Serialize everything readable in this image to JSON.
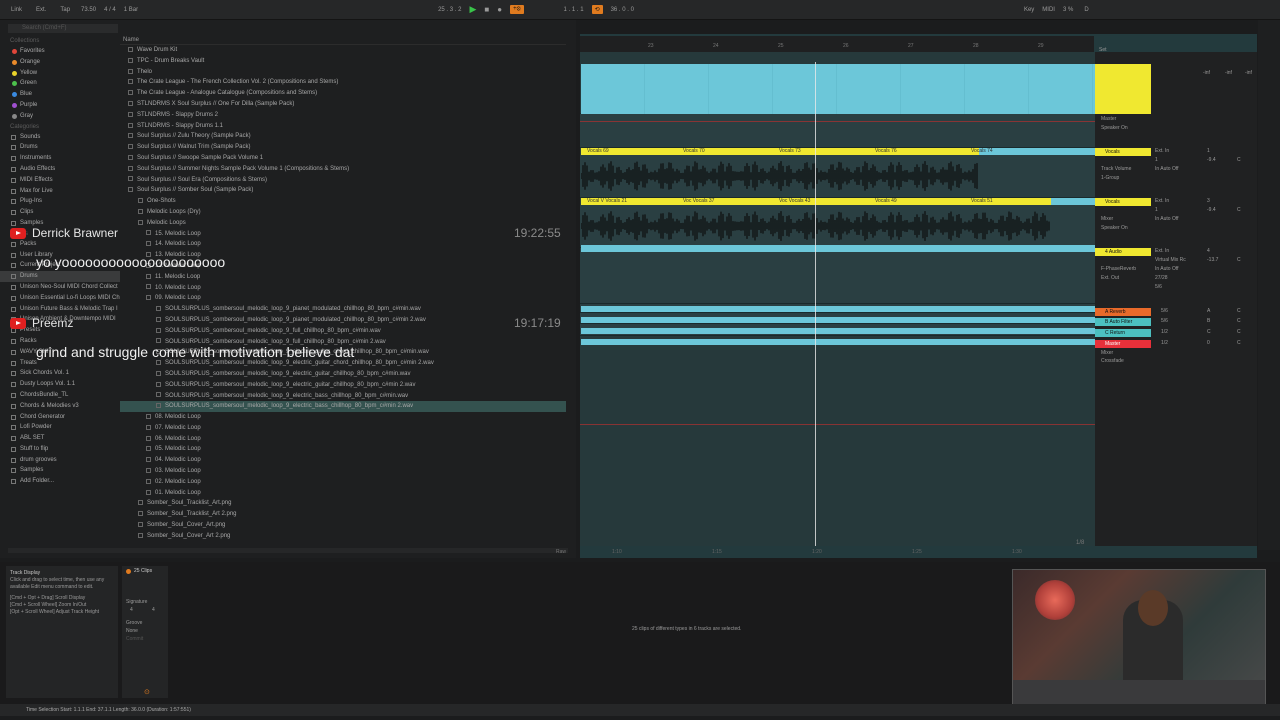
{
  "topbar": {
    "link": "Link",
    "ext": "Ext.",
    "tap": "Tap",
    "tempo": "73.50",
    "sig": "4 / 4",
    "quant": "1 Bar",
    "position": "25 . 3 . 2",
    "loop_start": "1 . 1 . 1",
    "loop_len": "36 . 0 . 0",
    "key": "Key",
    "midi": "MIDI",
    "cpu": "3 %",
    "d_btn": "D"
  },
  "browser": {
    "search_placeholder": "Search (Cmd+F)",
    "collections_header": "Collections",
    "collections": [
      {
        "label": "Favorites",
        "color": "#e0463a"
      },
      {
        "label": "Orange",
        "color": "#e88a2a"
      },
      {
        "label": "Yellow",
        "color": "#e8d22a"
      },
      {
        "label": "Green",
        "color": "#4cc04c"
      },
      {
        "label": "Blue",
        "color": "#3a8ae0"
      },
      {
        "label": "Purple",
        "color": "#a050d0"
      },
      {
        "label": "Gray",
        "color": "#888888"
      }
    ],
    "categories_header": "Categories",
    "categories": [
      "Sounds",
      "Drums",
      "Instruments",
      "Audio Effects",
      "MIDI Effects",
      "Max for Live",
      "Plug-Ins",
      "Clips",
      "Samples"
    ],
    "places_header": "Places",
    "places": [
      "Packs",
      "User Library",
      "Current Project",
      "Drums",
      "Unison Neo-Soul MIDI Chord Collect",
      "Unison Essential Lo-fi Loops MIDI Ch",
      "Unison Future Bass & Melodic Trap I",
      "Unison Ambient & Downtempo MIDI",
      "Presets",
      "Racks",
      "WAVY SHIT",
      "Treats",
      "Sick Chords Vol. 1",
      "Dusty Loops Vol. 1.1",
      "ChordsBundle_TL",
      "Chords & Melodies v3",
      "Chord Generator",
      "Lofi Powder",
      "ABL SET",
      "Stuff to flip",
      "drum grooves",
      "Samples",
      "Add Folder..."
    ],
    "name_header": "Name",
    "files": [
      "Wave Drum Kit",
      "TPC - Drum Breaks Vault",
      "Thelo",
      "The Crate League - The French Collection Vol. 2 (Compositions and Stems)",
      "The Crate League - Analogue Catalogue (Compositions and Stems)",
      "STLNDRMS X Soul Surplus // One For Dilla (Sample Pack)",
      "STLNDRMS - Slappy Drums 2",
      "STLNDRMS - Slappy Drums 1.1",
      "Soul Surplus // Zulu Theory (Sample Pack)",
      "Soul Surplus // Walnut Trim (Sample Pack)",
      "Soul Surplus // Swoope Sample Pack Volume 1",
      "Soul Surplus // Summer Nights Sample Pack Volume 1 (Compositions & Stems)",
      "Soul Surplus // Soul Era (Compositions & Stems)",
      "Soul Surplus // Somber Soul (Sample Pack)",
      "One-Shots",
      "Melodic Loops (Dry)",
      "Melodic Loops",
      "15. Melodic Loop",
      "14. Melodic Loop",
      "13. Melodic Loop",
      "12. Melodic Loop",
      "11. Melodic Loop",
      "10. Melodic Loop",
      "09. Melodic Loop",
      "SOULSURPLUS_sombersoul_melodic_loop_9_pianet_modulated_chillhop_80_bpm_c#min.wav",
      "SOULSURPLUS_sombersoul_melodic_loop_9_pianet_modulated_chillhop_80_bpm_c#min 2.wav",
      "SOULSURPLUS_sombersoul_melodic_loop_9_full_chillhop_80_bpm_c#min.wav",
      "SOULSURPLUS_sombersoul_melodic_loop_9_full_chillhop_80_bpm_c#min 2.wav",
      "SOULSURPLUS_sombersoul_melodic_loop_9_electric_guitar_chord_chillhop_80_bpm_c#min.wav",
      "SOULSURPLUS_sombersoul_melodic_loop_9_electric_guitar_chord_chillhop_80_bpm_c#min 2.wav",
      "SOULSURPLUS_sombersoul_melodic_loop_9_electric_guitar_chillhop_80_bpm_c#min.wav",
      "SOULSURPLUS_sombersoul_melodic_loop_9_electric_guitar_chillhop_80_bpm_c#min 2.wav",
      "SOULSURPLUS_sombersoul_melodic_loop_9_electric_bass_chillhop_80_bpm_c#min.wav",
      "SOULSURPLUS_sombersoul_melodic_loop_9_electric_bass_chillhop_80_bpm_c#min 2.wav",
      "08. Melodic Loop",
      "07. Melodic Loop",
      "06. Melodic Loop",
      "05. Melodic Loop",
      "04. Melodic Loop",
      "03. Melodic Loop",
      "02. Melodic Loop",
      "01. Melodic Loop",
      "Somber_Soul_Tracklist_Art.png",
      "Somber_Soul_Tracklist_Art 2.png",
      "Somber_Soul_Cover_Art.png",
      "Somber_Soul_Cover_Art 2.png"
    ],
    "raw_label": "Raw"
  },
  "chat": [
    {
      "user": "Derrick Brawner",
      "time": "19:22:55",
      "message": "yo yooooooooooooooooooooo"
    },
    {
      "user": "Preemz",
      "time": "19:17:19",
      "message": "grind and struggle come with motivation believe dat"
    }
  ],
  "arrangement": {
    "ruler": [
      "23",
      "24",
      "25",
      "26",
      "27",
      "28",
      "29"
    ],
    "time_ruler": [
      "1:10",
      "1:15",
      "1:20",
      "1:25",
      "1:30"
    ],
    "zoom": "1/8",
    "set_label": "Set",
    "clip_labels_vocals1": [
      "Vocals 69",
      "Vocals 70",
      "Vocals 73",
      "Vocals 76",
      "Vocals 74"
    ],
    "clip_labels_vocals2": [
      "Vocal V Vocals 21",
      "Voc Vocals 37",
      "Voc Vocals 43",
      "Vocals 49",
      "Vocals 51"
    ]
  },
  "mixer": {
    "tracks": [
      {
        "name": "",
        "color": "#f0e830",
        "routing": "Master",
        "sends": "Speaker On",
        "val": "-inf",
        "val2": "-inf",
        "val3": "-inf"
      },
      {
        "name": "Vocals",
        "color": "#f0e830",
        "in": "Ext. In",
        "ch": "1",
        "monitor": "In  Auto  Off",
        "out": "Track Volume",
        "out2": "1-Group",
        "num": "1",
        "vol": "-9.4",
        "pan": "C"
      },
      {
        "name": "Vocals",
        "color": "#f0e830",
        "in": "Ext. In",
        "ch": "1",
        "monitor": "In  Auto  Off",
        "out": "Mixer",
        "out2": "Speaker On",
        "num": "3",
        "vol": "-9.4",
        "pan": "C"
      },
      {
        "name": "4 Audio",
        "color": "#f0e830",
        "in": "Ext. In",
        "ch": "Virtual Mix Rc",
        "monitor": "In  Auto  Off",
        "out": "F-PhaseReverb",
        "out2": "Ext. Out",
        "num": "4",
        "vol": "-13.7",
        "pan": "C",
        "extra": "27/28",
        "extra2": "5/6"
      },
      {
        "name": "A Reverb",
        "color": "#e86a2a",
        "route": "5/6",
        "num": "A",
        "pan": "C"
      },
      {
        "name": "B Auto Filter",
        "color": "#4cc0c0",
        "route": "5/6",
        "num": "B",
        "pan": "C"
      },
      {
        "name": "C Return",
        "color": "#4cc0c0",
        "route": "1/2",
        "num": "C",
        "pan": "C"
      },
      {
        "name": "Master",
        "color": "#e8303a",
        "route": "1/2",
        "sub": "Mixer",
        "sub2": "Crossfade",
        "num": "0",
        "pan": "C"
      }
    ]
  },
  "bottom": {
    "info_title": "Track Display",
    "info_text": "Click and drag to select time, then use any available Edit menu command to edit.",
    "info_shortcuts": [
      "[Cmd + Opt + Drag] Scroll Display",
      "[Cmd + Scroll Wheel] Zoom In/Out",
      "[Opt + Scroll Wheel] Adjust Track Height"
    ],
    "clip_title": "25 Clips",
    "signature_label": "Signature",
    "sig_num": "4",
    "sig_den": "4",
    "groove_label": "Groove",
    "groove_value": "None",
    "commit_label": "Commit",
    "selection_message": "25 clips of different types in 6 tracks are selected.",
    "status": "Time Selection     Start: 1.1.1     End: 37.1.1     Length: 36.0.0  (Duration: 1:57:551)"
  },
  "colors": {
    "accent": "#e07b1f",
    "clip_blue": "#6cc7d9",
    "clip_yellow": "#f0e830",
    "selected": "#34524f"
  }
}
